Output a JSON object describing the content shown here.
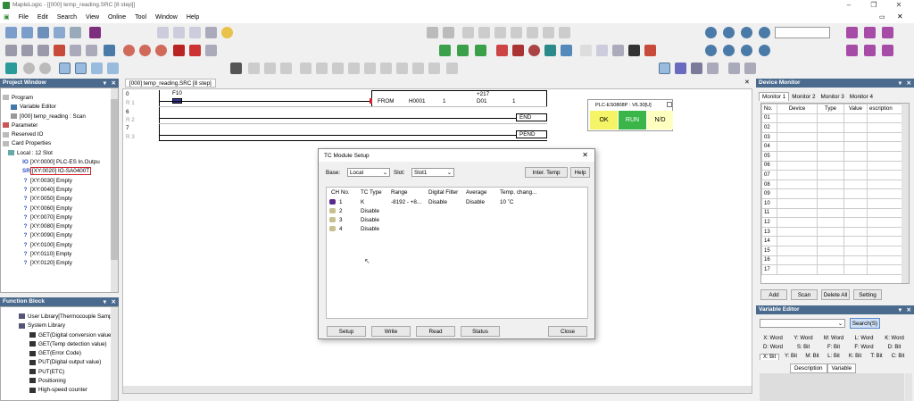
{
  "app": {
    "title": "MapleLogic - [[000] temp_reading.SRC [8 step]]"
  },
  "menu": [
    "File",
    "Edit",
    "Search",
    "View",
    "Online",
    "Tool",
    "Window",
    "Help"
  ],
  "project_window": {
    "title": "Project Window",
    "program_label": "Program",
    "variable_editor": "Variable Editor",
    "scan_program": "[000] temp_reading : Scan",
    "parameter": "Parameter",
    "reserved_io": "Reserved IO",
    "card_properties": "Card Properties",
    "local": "Local : 12 Slot",
    "slots": [
      "[XY:0000] PLC-ES In.Outpu",
      "[XY:0020] IO-SA0400T",
      "[XY:0030] Empty",
      "[XY:0040] Empty",
      "[XY:0050] Empty",
      "[XY:0060] Empty",
      "[XY:0070] Empty",
      "[XY:0080] Empty",
      "[XY:0090] Empty",
      "[XY:0100] Empty",
      "[XY:0110] Empty",
      "[XY:0120] Empty"
    ]
  },
  "function_block": {
    "title": "Function Block",
    "items": [
      "User Library[Thermocouple Samp",
      "System Library",
      "GET(Digital conversion value",
      "GET(Temp detection value)",
      "GET(Error Code)",
      "PUT(Digital output value)",
      "PUT(ETC)",
      "Positioning",
      "High-speed counter"
    ]
  },
  "editor": {
    "tab": "[000] temp_reading.SRC [8 step]",
    "steps": [
      "0",
      "R 1",
      "6",
      "R 2",
      "7",
      "R 3"
    ],
    "contact": "F10",
    "instr": "FROM",
    "h": "H0001",
    "n1": "1",
    "d": "D01",
    "n2": "1",
    "k": "+217",
    "end": "END",
    "pend": "PEND"
  },
  "plc_status": {
    "title": "PLC-ES0808P : V6.30[U]",
    "ok": "OK",
    "run": "RUN",
    "nd": "N/D"
  },
  "dialog": {
    "title": "TC Module Setup",
    "base_label": "Base:",
    "base": "Local",
    "slot_label": "Slot:",
    "slot": "Slot1",
    "inter_temp": "Inter. Temp",
    "help": "Help",
    "headers": [
      "CH No.",
      "TC Type",
      "Range",
      "Digital Filter",
      "Average",
      "Temp. chang..."
    ],
    "rows": [
      [
        "1",
        "K",
        "-8192 - +8...",
        "Disable",
        "Disable",
        "10 ˚C"
      ],
      [
        "2",
        "Disable",
        "",
        "",
        "",
        ""
      ],
      [
        "3",
        "Disable",
        "",
        "",
        "",
        ""
      ],
      [
        "4",
        "Disable",
        "",
        "",
        "",
        ""
      ]
    ],
    "buttons": [
      "Setup",
      "Write",
      "Read",
      "Status",
      "Close"
    ]
  },
  "device_monitor": {
    "title": "Device Monitor",
    "tabs": [
      "Monitor 1",
      "Monitor 2",
      "Monitor 3",
      "Monitor 4"
    ],
    "headers": [
      "No.",
      "Device",
      "Type",
      "Value",
      "escription"
    ],
    "rows": [
      "01",
      "02",
      "03",
      "04",
      "05",
      "06",
      "07",
      "08",
      "09",
      "10",
      "11",
      "12",
      "13",
      "14",
      "15",
      "16",
      "17"
    ],
    "buttons": [
      "Add",
      "Scan",
      "Delete All",
      "Setting"
    ]
  },
  "variable_editor": {
    "title": "Variable Editor",
    "search": "Search(S)",
    "keys": [
      [
        "X: Word",
        "Y: Word",
        "M: Word",
        "L: Word",
        "K: Word"
      ],
      [
        "D: Word",
        "S: Bit",
        "F: Bit",
        "F: Word",
        "D: Bit"
      ],
      [
        "X: Bit",
        "Y: Bit",
        "M: Bit",
        "L: Bit",
        "K: Bit",
        "T: Bit",
        "C: Bit"
      ]
    ],
    "tabs": [
      "Description",
      "Variable"
    ]
  },
  "colors": {
    "accent": "#4a6a8e",
    "ok": "#f4f466",
    "run": "#39b54a",
    "nd": "#ffffc0",
    "red": "#d0202a"
  }
}
